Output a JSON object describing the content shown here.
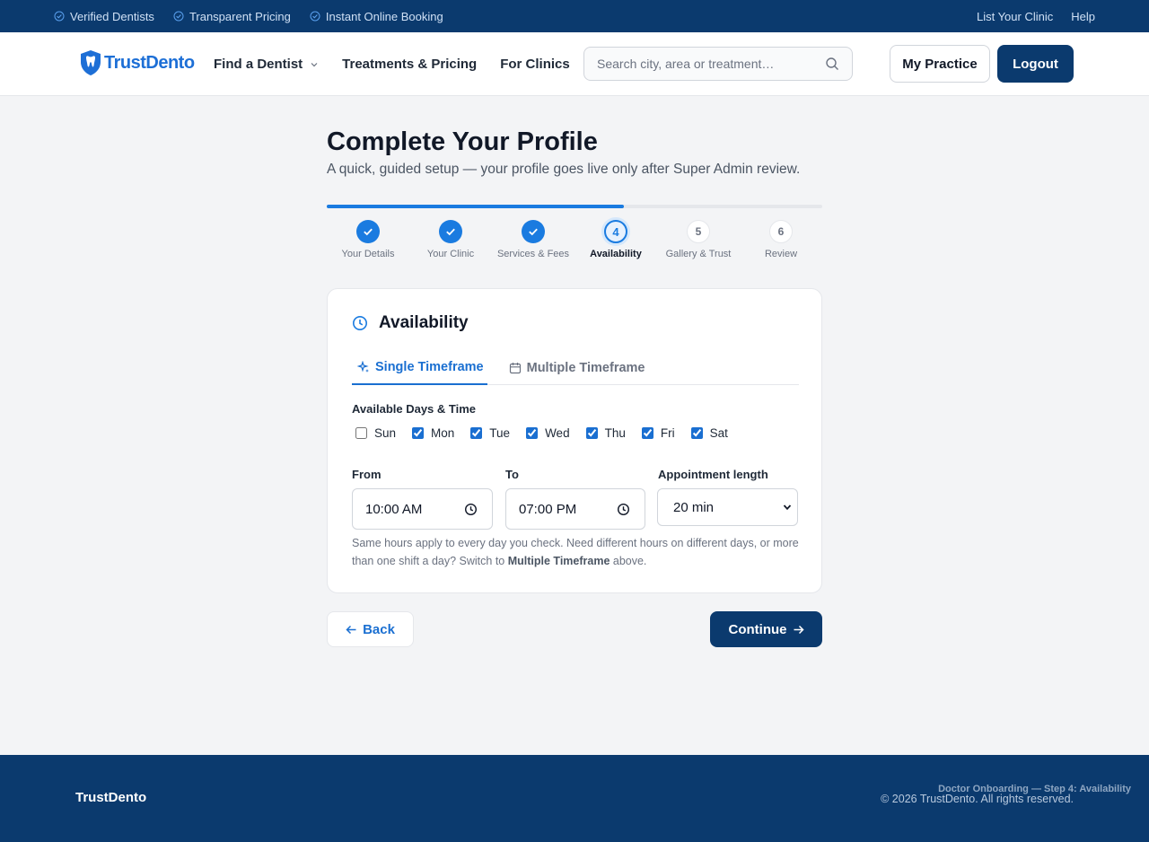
{
  "topbar": {
    "items": [
      "Verified Dentists",
      "Transparent Pricing",
      "Instant Online Booking"
    ],
    "right": [
      "List Your Clinic",
      "Help"
    ]
  },
  "header": {
    "brand": "TrustDento",
    "nav": [
      "Find a Dentist",
      "Treatments & Pricing",
      "For Clinics"
    ],
    "search_placeholder": "Search city, area or treatment…",
    "practice_label": "My Practice",
    "logout_label": "Logout"
  },
  "page": {
    "title": "Complete Your Profile",
    "subtitle": "A quick, guided setup — your profile goes live only after Super Admin review.",
    "progress_fraction": 0.6,
    "steps": [
      {
        "num": "1",
        "label": "Your Details",
        "state": "done"
      },
      {
        "num": "2",
        "label": "Your Clinic",
        "state": "done"
      },
      {
        "num": "3",
        "label": "Services & Fees",
        "state": "done"
      },
      {
        "num": "4",
        "label": "Availability",
        "state": "active"
      },
      {
        "num": "5",
        "label": "Gallery & Trust",
        "state": "pending"
      },
      {
        "num": "6",
        "label": "Review",
        "state": "pending"
      }
    ]
  },
  "card": {
    "title": "Availability",
    "tabs": [
      "Single Timeframe",
      "Multiple Timeframe"
    ],
    "days_label": "Available Days & Time",
    "days": [
      {
        "name": "Sun",
        "checked": false
      },
      {
        "name": "Mon",
        "checked": true
      },
      {
        "name": "Tue",
        "checked": true
      },
      {
        "name": "Wed",
        "checked": true
      },
      {
        "name": "Thu",
        "checked": true
      },
      {
        "name": "Fri",
        "checked": true
      },
      {
        "name": "Sat",
        "checked": true
      }
    ],
    "from_label": "From",
    "from_value": "10:00 AM",
    "to_label": "To",
    "to_value": "07:00 PM",
    "length_label": "Appointment length",
    "length_value": "20 min",
    "hint_pre": "Same hours apply to every day you check. Need different hours on different days, or more than one shift a day? Switch to ",
    "hint_bold": "Multiple Timeframe",
    "hint_post": " above."
  },
  "actions": {
    "back": "Back",
    "continue": "Continue"
  },
  "footer": {
    "brand": "TrustDento",
    "copyright": "© 2026 TrustDento. All rights reserved.",
    "step_note": "Doctor Onboarding — Step 4: Availability"
  },
  "colors": {
    "navy": "#0b3a6e",
    "accent": "#1a7be0"
  }
}
